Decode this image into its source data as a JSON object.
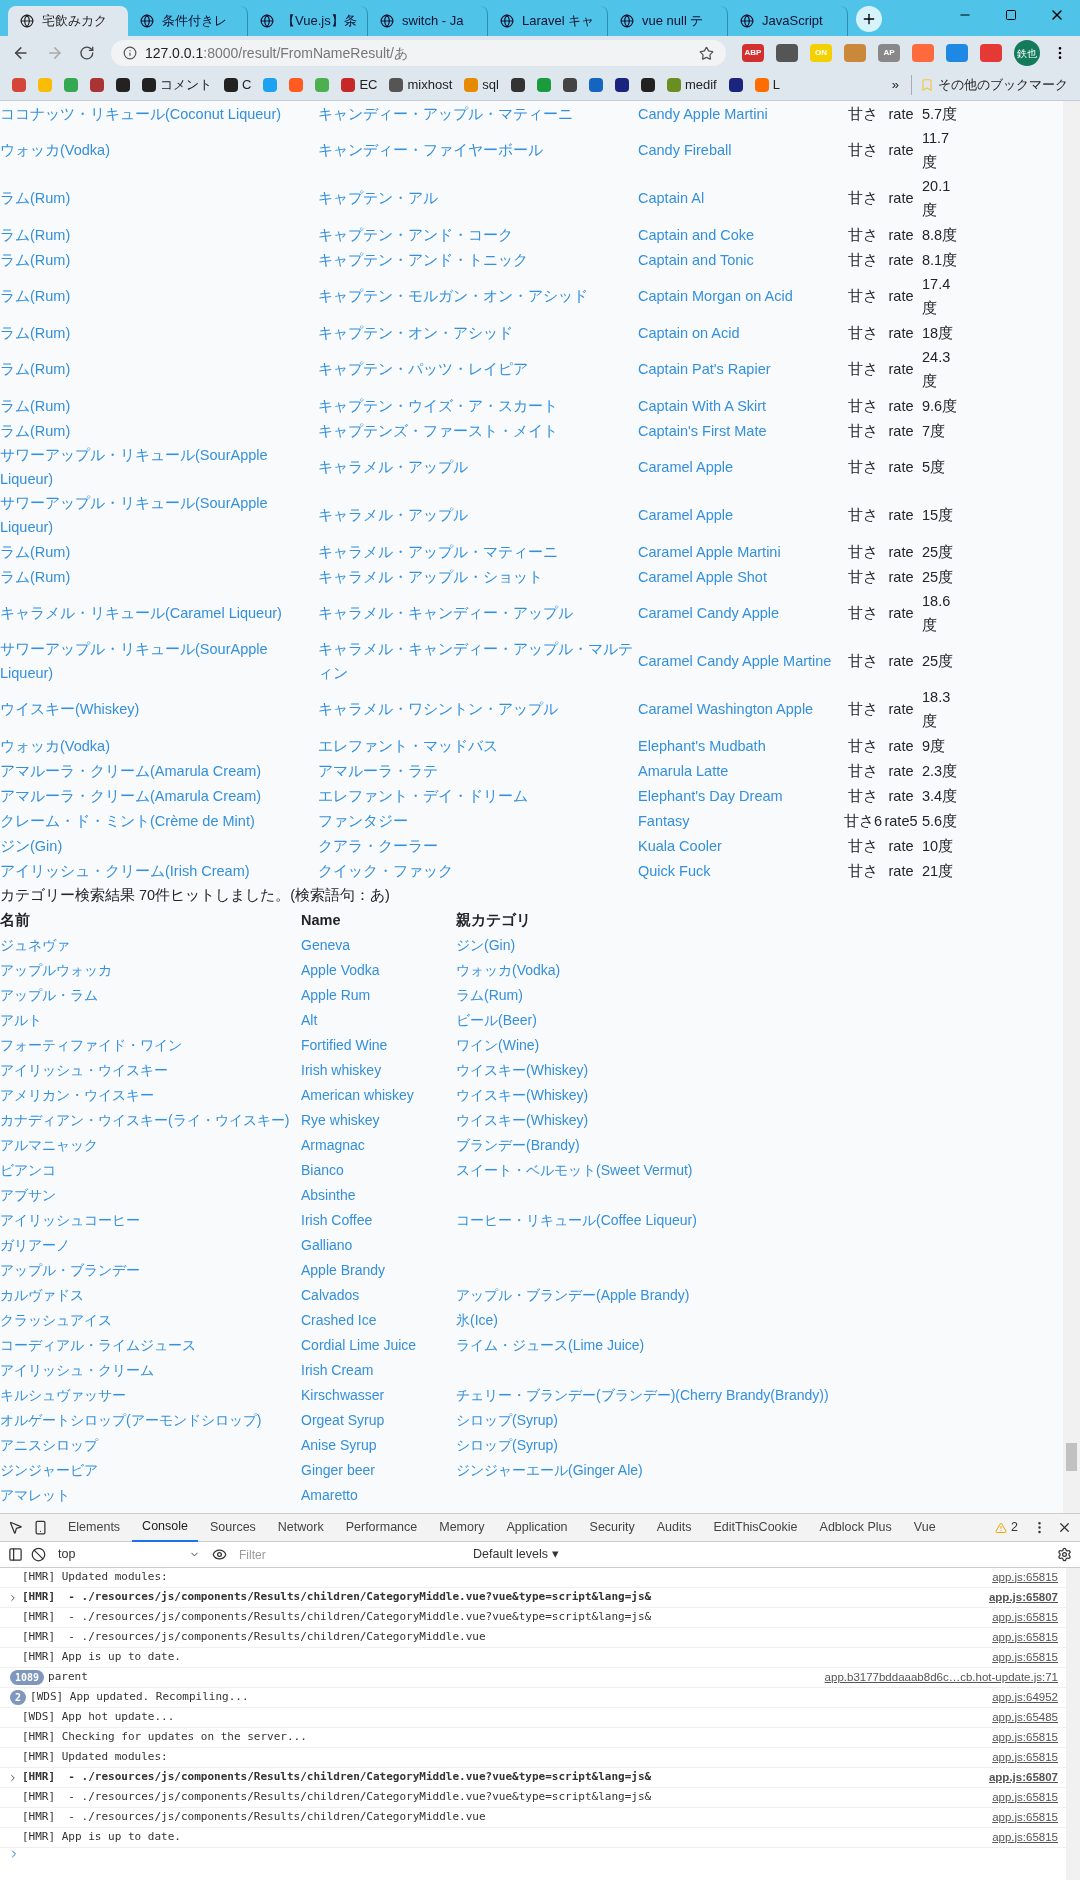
{
  "tabs": [
    {
      "title": "宅飲みカク",
      "selected": true
    },
    {
      "title": "条件付きレ",
      "selected": false
    },
    {
      "title": "【Vue.js】条",
      "selected": false
    },
    {
      "title": "switch - Ja",
      "selected": false
    },
    {
      "title": "Laravel キャ",
      "selected": false
    },
    {
      "title": "vue null テ",
      "selected": false
    },
    {
      "title": "JavaScript",
      "selected": false
    }
  ],
  "address": {
    "host": "127.0.0.1",
    "path": ":8000/result/FromNameResult/あ"
  },
  "extensions": [
    {
      "kind": "text",
      "text": "ABP"
    },
    {
      "kind": "icon"
    },
    {
      "kind": "text",
      "text": "ON"
    },
    {
      "kind": "icon"
    },
    {
      "kind": "text",
      "text": "AP"
    },
    {
      "kind": "icon"
    },
    {
      "kind": "icon"
    },
    {
      "kind": "icon"
    }
  ],
  "profile": "鉄也",
  "bookmarks": [
    {
      "kind": "icon"
    },
    {
      "kind": "icon"
    },
    {
      "kind": "icon"
    },
    {
      "kind": "icon"
    },
    {
      "kind": "icon"
    },
    {
      "kind": "text",
      "label": "コメント"
    },
    {
      "kind": "text",
      "label": "C"
    },
    {
      "kind": "icon"
    },
    {
      "kind": "icon"
    },
    {
      "kind": "icon"
    },
    {
      "kind": "text",
      "label": "EC"
    },
    {
      "kind": "text",
      "label": "mixhost"
    },
    {
      "kind": "text",
      "label": "sql"
    },
    {
      "kind": "icon"
    },
    {
      "kind": "icon"
    },
    {
      "kind": "icon"
    },
    {
      "kind": "icon"
    },
    {
      "kind": "icon"
    },
    {
      "kind": "icon"
    },
    {
      "kind": "text",
      "label": "medif"
    },
    {
      "kind": "icon"
    },
    {
      "kind": "text",
      "label": "L"
    }
  ],
  "bookmarks_more": "»",
  "other_bookmarks": "その他のブックマーク",
  "cocktails": [
    {
      "base": "ココナッツ・リキュール(Coconut Liqueur)",
      "name_ja": "キャンディー・アップル・マティーニ",
      "name_en": "Candy Apple Martini",
      "sweet": "甘さ",
      "rate": "rate",
      "abv": "5.7度"
    },
    {
      "base": "ウォッカ(Vodka)",
      "name_ja": "キャンディー・ファイヤーボール",
      "name_en": "Candy Fireball",
      "sweet": "甘さ",
      "rate": "rate",
      "abv": "11.7度"
    },
    {
      "base": "ラム(Rum)",
      "name_ja": "キャプテン・アル",
      "name_en": "Captain Al",
      "sweet": "甘さ",
      "rate": "rate",
      "abv": "20.1度"
    },
    {
      "base": "ラム(Rum)",
      "name_ja": "キャプテン・アンド・コーク",
      "name_en": "Captain and Coke",
      "sweet": "甘さ",
      "rate": "rate",
      "abv": "8.8度"
    },
    {
      "base": "ラム(Rum)",
      "name_ja": "キャプテン・アンド・トニック",
      "name_en": "Captain and Tonic",
      "sweet": "甘さ",
      "rate": "rate",
      "abv": "8.1度"
    },
    {
      "base": "ラム(Rum)",
      "name_ja": "キャプテン・モルガン・オン・アシッド",
      "name_en": "Captain Morgan on Acid",
      "sweet": "甘さ",
      "rate": "rate",
      "abv": "17.4度"
    },
    {
      "base": "ラム(Rum)",
      "name_ja": "キャプテン・オン・アシッド",
      "name_en": "Captain on Acid",
      "sweet": "甘さ",
      "rate": "rate",
      "abv": "18度"
    },
    {
      "base": "ラム(Rum)",
      "name_ja": "キャプテン・パッツ・レイピア",
      "name_en": "Captain Pat's Rapier",
      "sweet": "甘さ",
      "rate": "rate",
      "abv": "24.3度"
    },
    {
      "base": "ラム(Rum)",
      "name_ja": "キャプテン・ウイズ・ア・スカート",
      "name_en": "Captain With A Skirt",
      "sweet": "甘さ",
      "rate": "rate",
      "abv": "9.6度"
    },
    {
      "base": "ラム(Rum)",
      "name_ja": "キャプテンズ・ファースト・メイト",
      "name_en": "Captain's First Mate",
      "sweet": "甘さ",
      "rate": "rate",
      "abv": "7度"
    },
    {
      "base": "サワーアップル・リキュール(SourApple Liqueur)",
      "name_ja": "キャラメル・アップル",
      "name_en": "Caramel Apple",
      "sweet": "甘さ",
      "rate": "rate",
      "abv": "5度"
    },
    {
      "base": "サワーアップル・リキュール(SourApple Liqueur)",
      "name_ja": "キャラメル・アップル",
      "name_en": "Caramel Apple",
      "sweet": "甘さ",
      "rate": "rate",
      "abv": "15度"
    },
    {
      "base": "ラム(Rum)",
      "name_ja": "キャラメル・アップル・マティーニ",
      "name_en": "Caramel Apple Martini",
      "sweet": "甘さ",
      "rate": "rate",
      "abv": "25度"
    },
    {
      "base": "ラム(Rum)",
      "name_ja": "キャラメル・アップル・ショット",
      "name_en": "Caramel Apple Shot",
      "sweet": "甘さ",
      "rate": "rate",
      "abv": "25度"
    },
    {
      "base": "キャラメル・リキュール(Caramel Liqueur)",
      "name_ja": "キャラメル・キャンディー・アップル",
      "name_en": "Caramel Candy Apple",
      "sweet": "甘さ",
      "rate": "rate",
      "abv": "18.6度"
    },
    {
      "base": "サワーアップル・リキュール(SourApple Liqueur)",
      "name_ja": "キャラメル・キャンディー・アップル・マルティン",
      "name_en": "Caramel Candy Apple Martine",
      "sweet": "甘さ",
      "rate": "rate",
      "abv": "25度"
    },
    {
      "base": "ウイスキー(Whiskey)",
      "name_ja": "キャラメル・ワシントン・アップル",
      "name_en": "Caramel Washington Apple",
      "sweet": "甘さ",
      "rate": "rate",
      "abv": "18.3度"
    },
    {
      "base": "ウォッカ(Vodka)",
      "name_ja": "エレファント・マッドバス",
      "name_en": "Elephant's Mudbath",
      "sweet": "甘さ",
      "rate": "rate",
      "abv": "9度"
    },
    {
      "base": "アマルーラ・クリーム(Amarula Cream)",
      "name_ja": "アマルーラ・ラテ",
      "name_en": "Amarula Latte",
      "sweet": "甘さ",
      "rate": "rate",
      "abv": "2.3度"
    },
    {
      "base": "アマルーラ・クリーム(Amarula Cream)",
      "name_ja": "エレファント・デイ・ドリーム",
      "name_en": "Elephant's Day Dream",
      "sweet": "甘さ",
      "rate": "rate",
      "abv": "3.4度"
    },
    {
      "base": "クレーム・ド・ミント(Crème de Mint)",
      "name_ja": "ファンタジー",
      "name_en": "Fantasy",
      "sweet": "甘さ6",
      "rate": "rate5",
      "abv": "5.6度"
    },
    {
      "base": "ジン(Gin)",
      "name_ja": "クアラ・クーラー",
      "name_en": "Kuala Cooler",
      "sweet": "甘さ",
      "rate": "rate",
      "abv": "10度"
    },
    {
      "base": "アイリッシュ・クリーム(Irish Cream)",
      "name_ja": "クイック・ファック",
      "name_en": "Quick Fuck",
      "sweet": "甘さ",
      "rate": "rate",
      "abv": "21度"
    }
  ],
  "category_summary": "カテゴリー検索結果 70件ヒットしました。(検索語句：あ)",
  "category_columns": [
    "名前",
    "Name",
    "親カテゴリ"
  ],
  "categories": [
    {
      "ja": "ジュネヴァ",
      "en": "Geneva",
      "parent": "ジン(Gin)"
    },
    {
      "ja": "アップルウォッカ",
      "en": "Apple Vodka",
      "parent": "ウォッカ(Vodka)"
    },
    {
      "ja": "アップル・ラム",
      "en": "Apple Rum",
      "parent": "ラム(Rum)"
    },
    {
      "ja": "アルト",
      "en": "Alt",
      "parent": "ビール(Beer)"
    },
    {
      "ja": "フォーティファイド・ワイン",
      "en": "Fortified Wine",
      "parent": "ワイン(Wine)"
    },
    {
      "ja": "アイリッシュ・ウイスキー",
      "en": "Irish whiskey",
      "parent": "ウイスキー(Whiskey)"
    },
    {
      "ja": "アメリカン・ウイスキー",
      "en": "American whiskey",
      "parent": "ウイスキー(Whiskey)"
    },
    {
      "ja": "カナディアン・ウイスキー(ライ・ウイスキー)",
      "en": "Rye whiskey",
      "parent": "ウイスキー(Whiskey)"
    },
    {
      "ja": "アルマニャック",
      "en": "Armagnac",
      "parent": "ブランデー(Brandy)"
    },
    {
      "ja": "ビアンコ",
      "en": "Bianco",
      "parent": "スイート・ベルモット(Sweet Vermut)"
    },
    {
      "ja": "アブサン",
      "en": "Absinthe"
    },
    {
      "ja": "アイリッシュコーヒー",
      "en": "Irish Coffee",
      "parent": "コーヒー・リキュール(Coffee Liqueur)"
    },
    {
      "ja": "ガリアーノ",
      "en": "Galliano"
    },
    {
      "ja": "アップル・ブランデー",
      "en": "Apple Brandy"
    },
    {
      "ja": "カルヴァドス",
      "en": "Calvados",
      "parent": "アップル・ブランデー(Apple Brandy)"
    },
    {
      "ja": "クラッシュアイス",
      "en": "Crashed Ice",
      "parent": "氷(Ice)"
    },
    {
      "ja": "コーディアル・ライムジュース",
      "en": "Cordial Lime Juice",
      "parent": "ライム・ジュース(Lime Juice)"
    },
    {
      "ja": "アイリッシュ・クリーム",
      "en": "Irish Cream"
    },
    {
      "ja": "キルシュヴァッサー",
      "en": "Kirschwasser",
      "parent": "チェリー・ブランデー(ブランデー)(Cherry Brandy(Brandy))"
    },
    {
      "ja": "オルゲートシロップ(アーモンドシロップ)",
      "en": "Orgeat Syrup",
      "parent": "シロップ(Syrup)"
    },
    {
      "ja": "アニスシロップ",
      "en": "Anise Syrup",
      "parent": "シロップ(Syrup)"
    },
    {
      "ja": "ジンジャービア",
      "en": "Ginger beer",
      "parent": "ジンジャーエール(Ginger Ale)"
    },
    {
      "ja": "アマレット",
      "en": "Amaretto"
    }
  ],
  "devtools": {
    "tabs": [
      {
        "label": "Elements",
        "selected": false
      },
      {
        "label": "Console",
        "selected": true
      },
      {
        "label": "Sources",
        "selected": false
      },
      {
        "label": "Network",
        "selected": false
      },
      {
        "label": "Performance",
        "selected": false
      },
      {
        "label": "Memory",
        "selected": false
      },
      {
        "label": "Application",
        "selected": false
      },
      {
        "label": "Security",
        "selected": false
      },
      {
        "label": "Audits",
        "selected": false
      },
      {
        "label": "EditThisCookie",
        "selected": false
      },
      {
        "label": "Adblock Plus",
        "selected": false
      },
      {
        "label": "Vue",
        "selected": false
      }
    ],
    "warnings": "2",
    "context": "top",
    "filter_placeholder": "Filter",
    "levels": "Default levels ▾",
    "lines": [
      {
        "kind": "plain",
        "text": "[HMR] Updated modules:",
        "source": "app.js:65815"
      },
      {
        "kind": "group",
        "text": "[HMR]  - ./resources/js/components/Results/children/CategoryMiddle.vue?vue&type=script&lang=js&",
        "source": "app.js:65807"
      },
      {
        "kind": "plain",
        "text": "[HMR]  - ./resources/js/components/Results/children/CategoryMiddle.vue?vue&type=script&lang=js&",
        "source": "app.js:65815"
      },
      {
        "kind": "plain",
        "text": "[HMR]  - ./resources/js/components/Results/children/CategoryMiddle.vue",
        "source": "app.js:65815"
      },
      {
        "kind": "plain",
        "text": "[HMR] App is up to date.",
        "source": "app.js:65815"
      },
      {
        "kind": "count",
        "count": "1089",
        "text": "parent",
        "source": "app.b3177bddaaab8d6c…cb.hot-update.js:71"
      },
      {
        "kind": "count",
        "count": "2",
        "text": "[WDS] App updated. Recompiling...",
        "source": "app.js:64952"
      },
      {
        "kind": "plain",
        "text": "[WDS] App hot update...",
        "source": "app.js:65485"
      },
      {
        "kind": "plain",
        "text": "[HMR] Checking for updates on the server...",
        "source": "app.js:65815"
      },
      {
        "kind": "plain",
        "text": "[HMR] Updated modules:",
        "source": "app.js:65815"
      },
      {
        "kind": "group",
        "text": "[HMR]  - ./resources/js/components/Results/children/CategoryMiddle.vue?vue&type=script&lang=js&",
        "source": "app.js:65807"
      },
      {
        "kind": "plain",
        "text": "[HMR]  - ./resources/js/components/Results/children/CategoryMiddle.vue?vue&type=script&lang=js&",
        "source": "app.js:65815"
      },
      {
        "kind": "plain",
        "text": "[HMR]  - ./resources/js/components/Results/children/CategoryMiddle.vue",
        "source": "app.js:65815"
      },
      {
        "kind": "plain",
        "text": "[HMR] App is up to date.",
        "source": "app.js:65815"
      }
    ]
  }
}
